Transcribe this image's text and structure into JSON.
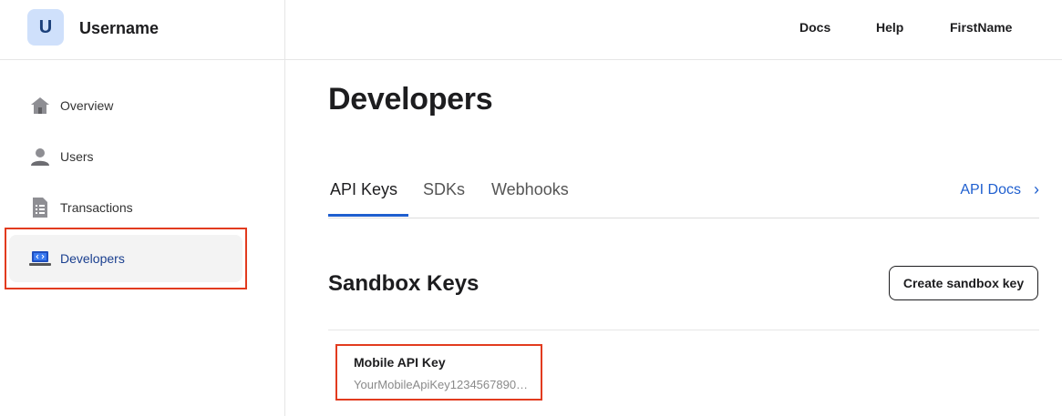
{
  "brand": {
    "initial": "U",
    "name": "Username"
  },
  "sidebar": {
    "items": [
      {
        "label": "Overview",
        "icon": "home-icon"
      },
      {
        "label": "Users",
        "icon": "user-icon"
      },
      {
        "label": "Transactions",
        "icon": "document-icon"
      },
      {
        "label": "Developers",
        "icon": "laptop-code-icon",
        "active": true
      }
    ]
  },
  "topbar": {
    "docs": "Docs",
    "help": "Help",
    "user": "FirstName"
  },
  "main": {
    "title": "Developers",
    "tabs": [
      {
        "label": "API Keys",
        "active": true
      },
      {
        "label": "SDKs"
      },
      {
        "label": "Webhooks"
      }
    ],
    "api_docs": "API Docs",
    "section_title": "Sandbox Keys",
    "create_button": "Create sandbox key",
    "keys": [
      {
        "name": "Mobile API Key",
        "value": "YourMobileApiKey1234567890…"
      }
    ]
  },
  "colors": {
    "accent": "#1f5fcf",
    "highlight": "#e23b1f",
    "avatar_bg": "#cfe0fb"
  }
}
